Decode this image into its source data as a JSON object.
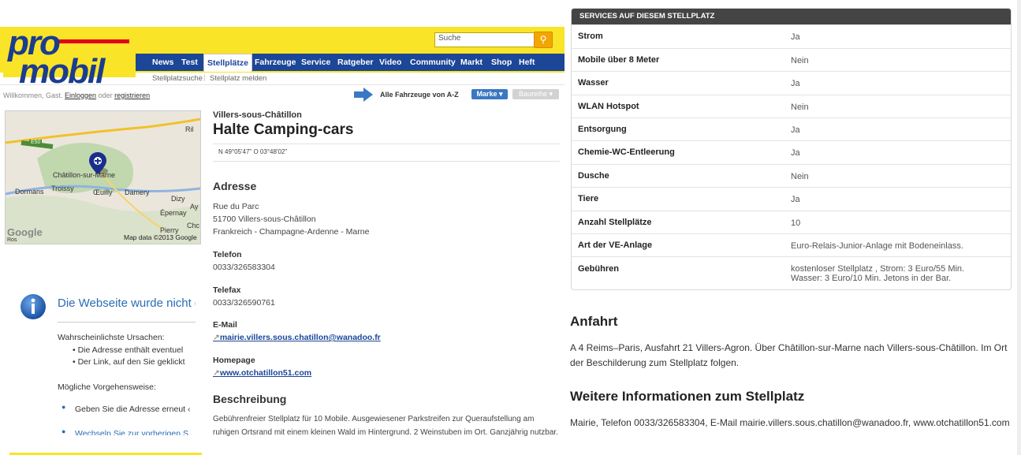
{
  "site": {
    "logo_line1": "pro",
    "logo_line2": "mobil",
    "search_placeholder": "Suche",
    "search_icon": "magnifier-icon",
    "nav": [
      "News",
      "Test",
      "Stellplätze",
      "Fahrzeuge",
      "Service",
      "Ratgeber",
      "Video",
      "Community",
      "Markt",
      "Shop",
      "Heft"
    ],
    "active_nav": "Stellplätze",
    "subnav": [
      "Stellplatzsuche",
      "Stellplatz melden"
    ],
    "welcome_prefix": "Willkommen, Gast.",
    "login": "Einloggen",
    "or": "oder",
    "register": "registrieren",
    "vehicles_label": "Alle Fahrzeuge von A-Z",
    "marke_label": "Marke ▾",
    "baureihe_label": "Baureihe ▾",
    "brand_yellow": "#f9e428",
    "brand_blue": "#1c4697"
  },
  "map": {
    "labels": [
      "Châtillon-sur-Marne",
      "Dormans",
      "Troissy",
      "Œuilly",
      "Damery",
      "Dizy",
      "Ay",
      "Épernay",
      "Pierry",
      "Chc",
      "Ril",
      "E50",
      "Ros"
    ],
    "google": "Google",
    "attribution": "Map data ©2013 Google",
    "marker_icon": "map-pin-icon"
  },
  "place": {
    "town": "Villers-sous-Châtillon",
    "name": "Halte Camping-cars",
    "coordinates": "N 49°05'47\"  O 03°48'02\"",
    "address_heading": "Adresse",
    "address_lines": [
      "Rue du Parc",
      "51700 Villers-sous-Châtillon",
      "Frankreich - Champagne-Ardenne - Marne"
    ],
    "phone_label": "Telefon",
    "phone": "0033/326583304",
    "fax_label": "Telefax",
    "fax": "0033/326590761",
    "email_label": "E-Mail",
    "email": "mairie.villers.sous.chatillon@wanadoo.fr",
    "homepage_label": "Homepage",
    "homepage": "www.otchatillon51.com",
    "description_heading": "Beschreibung",
    "description": "Gebührenfreier Stellplatz für 10 Mobile. Ausgewiesener Parkstreifen zur Queraufstellung am ruhigen Ortsrand mit einem kleinen Wald im Hintergrund. 2 Weinstuben im Ort. Ganzjährig nutzbar."
  },
  "error_panel": {
    "title": "Die Webseite wurde nicht ge",
    "causes_heading": "Wahrscheinlichste Ursachen:",
    "causes": [
      "Die Adresse enthält eventuel",
      "Der Link, auf den Sie geklickt"
    ],
    "steps_heading": "Mögliche Vorgehensweise:",
    "step1": "Geben Sie die Adresse erneut ‹",
    "step2": "Wechseln Sie zur vorherigen S"
  },
  "services": {
    "heading": "SERVICES AUF DIESEM STELLPLATZ",
    "rows": [
      {
        "key": "Strom",
        "value": "Ja"
      },
      {
        "key": "Mobile über 8 Meter",
        "value": "Nein"
      },
      {
        "key": "Wasser",
        "value": "Ja"
      },
      {
        "key": "WLAN Hotspot",
        "value": "Nein"
      },
      {
        "key": "Entsorgung",
        "value": "Ja"
      },
      {
        "key": "Chemie-WC-Entleerung",
        "value": "Ja"
      },
      {
        "key": "Dusche",
        "value": "Nein"
      },
      {
        "key": "Tiere",
        "value": "Ja"
      },
      {
        "key": "Anzahl Stellplätze",
        "value": "10"
      },
      {
        "key": "Art der VE-Anlage",
        "value": "Euro-Relais-Junior-Anlage mit Bodeneinlass."
      },
      {
        "key": "Gebühren",
        "value": "kostenloser Stellplatz , Strom: 3 Euro/55 Min.",
        "value2": "Wasser: 3 Euro/10 Min. Jetons in der Bar."
      }
    ]
  },
  "anfahrt": {
    "heading": "Anfahrt",
    "text": "A 4 Reims–Paris, Ausfahrt 21 Villers-Agron. Über Châtillon-sur-Marne nach Villers-sous-Châtillon. Im Ort der Beschilderung zum Stellplatz folgen."
  },
  "weitere": {
    "heading": "Weitere Informationen zum Stellplatz",
    "text": "Mairie, Telefon 0033/326583304, E-Mail mairie.villers.sous.chatillon@wanadoo.fr, www.otchatillon51.com"
  }
}
